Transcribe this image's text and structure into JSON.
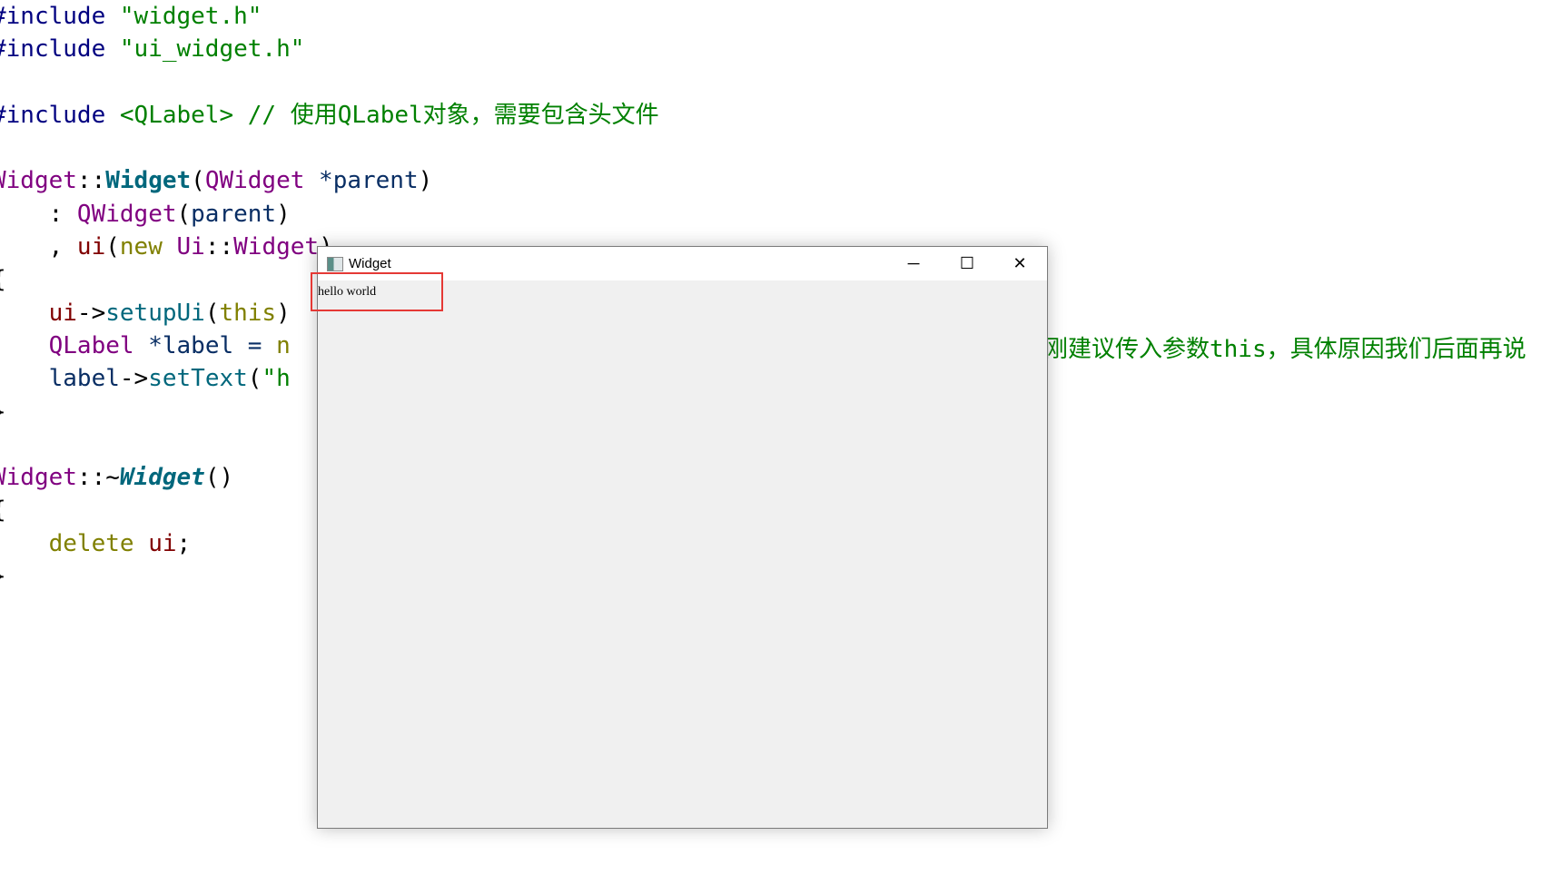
{
  "code_lines": [
    [
      {
        "t": "#include ",
        "c": "kw"
      },
      {
        "t": "\"widget.h\"",
        "c": "str"
      }
    ],
    [
      {
        "t": "#include ",
        "c": "kw"
      },
      {
        "t": "\"ui_widget.h\"",
        "c": "str"
      }
    ],
    [],
    [
      {
        "t": "#include ",
        "c": "kw"
      },
      {
        "t": "<QLabel>",
        "c": "str"
      },
      {
        "t": " // 使用QLabel对象，需要包含头文件",
        "c": "cm"
      }
    ],
    [],
    [
      {
        "t": "Widget",
        "c": "cls"
      },
      {
        "t": "::",
        "c": "p"
      },
      {
        "t": "Widget",
        "c": "fn"
      },
      {
        "t": "(",
        "c": "p"
      },
      {
        "t": "QWidget",
        "c": "cls"
      },
      {
        "t": " *parent",
        "c": "var"
      },
      {
        "t": ")",
        "c": "p"
      }
    ],
    [
      {
        "t": "    : ",
        "c": "p"
      },
      {
        "t": "QWidget",
        "c": "cls"
      },
      {
        "t": "(",
        "c": "p"
      },
      {
        "t": "parent",
        "c": "var"
      },
      {
        "t": ")",
        "c": "p"
      }
    ],
    [
      {
        "t": "    , ",
        "c": "p"
      },
      {
        "t": "ui",
        "c": "mem"
      },
      {
        "t": "(",
        "c": "p"
      },
      {
        "t": "new",
        "c": "ol"
      },
      {
        "t": " Ui",
        "c": "cls"
      },
      {
        "t": "::",
        "c": "p"
      },
      {
        "t": "Widget",
        "c": "cls"
      },
      {
        "t": ")",
        "c": "p"
      }
    ],
    [
      {
        "t": "{",
        "c": "p"
      }
    ],
    [
      {
        "t": "    ui",
        "c": "mem"
      },
      {
        "t": "->",
        "c": "p"
      },
      {
        "t": "setupUi",
        "c": "call"
      },
      {
        "t": "(",
        "c": "p"
      },
      {
        "t": "this",
        "c": "ol"
      },
      {
        "t": ")",
        "c": "p"
      }
    ],
    [
      {
        "t": "    QLabel",
        "c": "cls"
      },
      {
        "t": " *label = ",
        "c": "var"
      },
      {
        "t": "n",
        "c": "ol"
      }
    ],
    [
      {
        "t": "    label",
        "c": "var"
      },
      {
        "t": "->",
        "c": "p"
      },
      {
        "t": "setText",
        "c": "call"
      },
      {
        "t": "(",
        "c": "p"
      },
      {
        "t": "\"h",
        "c": "str"
      }
    ],
    [
      {
        "t": "}",
        "c": "p"
      }
    ],
    [],
    [
      {
        "t": "Widget",
        "c": "cls"
      },
      {
        "t": "::~",
        "c": "p"
      },
      {
        "t": "Widget",
        "c": "fni"
      },
      {
        "t": "()",
        "c": "p"
      }
    ],
    [
      {
        "t": "{",
        "c": "p"
      }
    ],
    [
      {
        "t": "    delete",
        "c": "ol"
      },
      {
        "t": " ui",
        "c": "mem"
      },
      {
        "t": ";",
        "c": "p"
      }
    ],
    [
      {
        "t": "}",
        "c": "p"
      }
    ]
  ],
  "right_comment": "刚建议传入参数this，具体原因我们后面再说",
  "window": {
    "title": "Widget",
    "icon": "qt-app-icon",
    "minimize": "─",
    "maximize": "☐",
    "close": "✕",
    "label_text": "hello world"
  },
  "highlight_color": "#e53935"
}
